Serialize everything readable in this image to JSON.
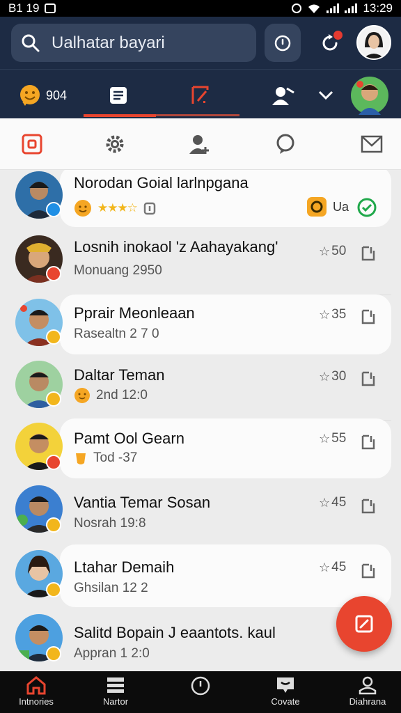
{
  "status_bar": {
    "time_left": "B1 19",
    "time_right": "13:29"
  },
  "header": {
    "search": {
      "text": "Ualhatar bayari",
      "icon": "search-icon"
    },
    "score_label": "904",
    "avatar_icon": "profile-avatar"
  },
  "toolbar": {
    "items": [
      "camera-icon",
      "gear-icon",
      "add-contact-icon",
      "chat-icon",
      "mail-icon"
    ]
  },
  "contacts": [
    {
      "name": "Norodan Goial larlnpgana",
      "sub": "",
      "score": "",
      "tag": "Ua",
      "verified": true,
      "badge_color": "#1f8fe5"
    },
    {
      "name": "Losnih inokaol 'z Aahayakang'",
      "sub": "Monuang 2950",
      "score": "50",
      "badge_color": "#e8452f"
    },
    {
      "name": "Pprair Meonleaan",
      "sub": "Rasealtn 2 7 0",
      "score": "35",
      "badge_color": "#f2b61c"
    },
    {
      "name": "Daltar Teman",
      "sub": "2nd 12:0",
      "score": "30",
      "badge_color": "#f2b61c"
    },
    {
      "name": "Pamt Ool Gearn",
      "sub": "Tod -37",
      "score": "55",
      "badge_color": "#e8452f"
    },
    {
      "name": "Vantia Temar Sosan",
      "sub": "Nosrah 19:8",
      "score": "45",
      "badge_color": "#f2b61c"
    },
    {
      "name": "Ltahar Demaih",
      "sub": "Ghsilan 12 2",
      "score": "45",
      "badge_color": "#f2b61c"
    },
    {
      "name": "Salitd Bopain J eaantots. kaul",
      "sub": "Appran 1 2:0",
      "score": "",
      "badge_color": "#f2b61c"
    }
  ],
  "bottom_nav": [
    {
      "label": "Intnories",
      "icon": "home-icon"
    },
    {
      "label": "Nartor",
      "icon": "list-icon"
    },
    {
      "label": "",
      "icon": "clock-icon"
    },
    {
      "label": "Covate",
      "icon": "chat-icon"
    },
    {
      "label": "Diahrana",
      "icon": "profile-icon"
    }
  ],
  "colors": {
    "header_bg": "#1d2b44",
    "accent": "#e8452f",
    "verified": "#1fa84a",
    "star": "#f2b61c"
  }
}
